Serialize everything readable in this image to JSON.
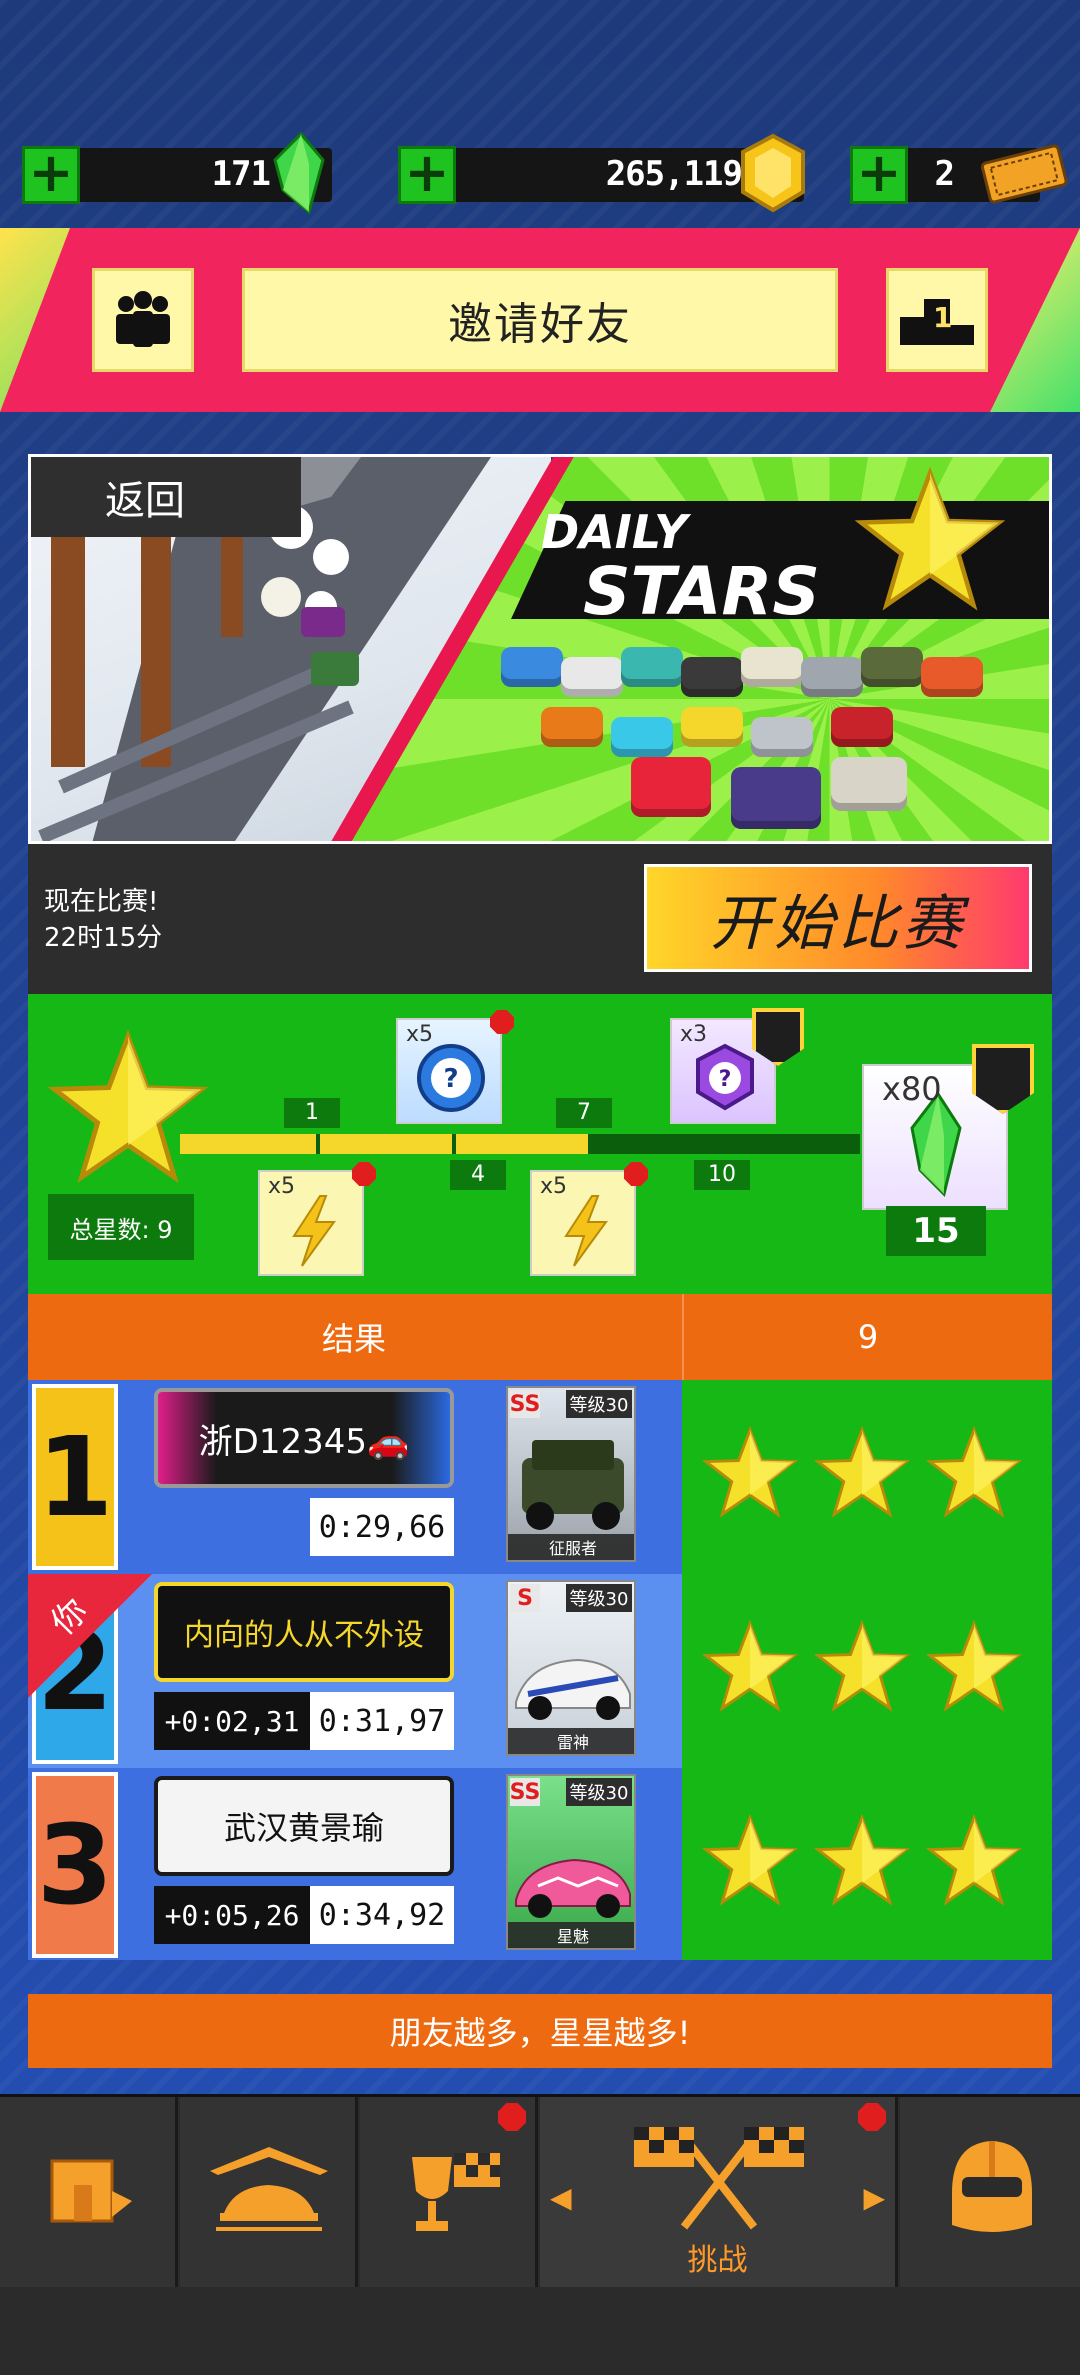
{
  "currency": {
    "gems": "171",
    "coins": "265,119",
    "tickets": "2"
  },
  "header": {
    "invite_label": "邀请好友",
    "rank_value": "1"
  },
  "event": {
    "back_label": "返回",
    "title_line1": "DAILY",
    "title_line2": "STARS",
    "race_now": "现在比赛!",
    "time_left": "22时15分",
    "start_label": "开始比赛"
  },
  "progress": {
    "total_label": "总星数: 9",
    "total_stars": 9,
    "max_stars": 15,
    "milestones": [
      "1",
      "4",
      "7",
      "10"
    ],
    "rewards": [
      {
        "count": "x5",
        "type": "bolt"
      },
      {
        "count": "x5",
        "type": "blue-crate"
      },
      {
        "count": "x5",
        "type": "bolt"
      },
      {
        "count": "x3",
        "type": "purple-crate"
      }
    ],
    "final_reward_count": "x80",
    "final_target": "15"
  },
  "results": {
    "col_result": "结果",
    "col_stars": "9",
    "rows": [
      {
        "rank": "1",
        "name": "浙D12345🚗",
        "diff": "",
        "time": "0:29,66",
        "car_class": "SS",
        "car_level": "等级30",
        "car_name": "征服者",
        "stars": 3
      },
      {
        "rank": "2",
        "name": "内向的人从不外设",
        "diff": "+0:02,31",
        "time": "0:31,97",
        "car_class": "S",
        "car_level": "等级30",
        "car_name": "雷神",
        "stars": 3,
        "is_you": true
      },
      {
        "rank": "3",
        "name": "武汉黄景瑜",
        "diff": "+0:05,26",
        "time": "0:34,92",
        "car_class": "SS",
        "car_level": "等级30",
        "car_name": "星魅",
        "stars": 3
      }
    ],
    "you_label": "你"
  },
  "promo": "朋友越多，星星越多!",
  "nav": {
    "active_label": "挑战"
  },
  "colors": {
    "accent_pink": "#f2245e",
    "green": "#16b816",
    "orange": "#ee6a10",
    "star_yellow": "#f5d62a"
  }
}
